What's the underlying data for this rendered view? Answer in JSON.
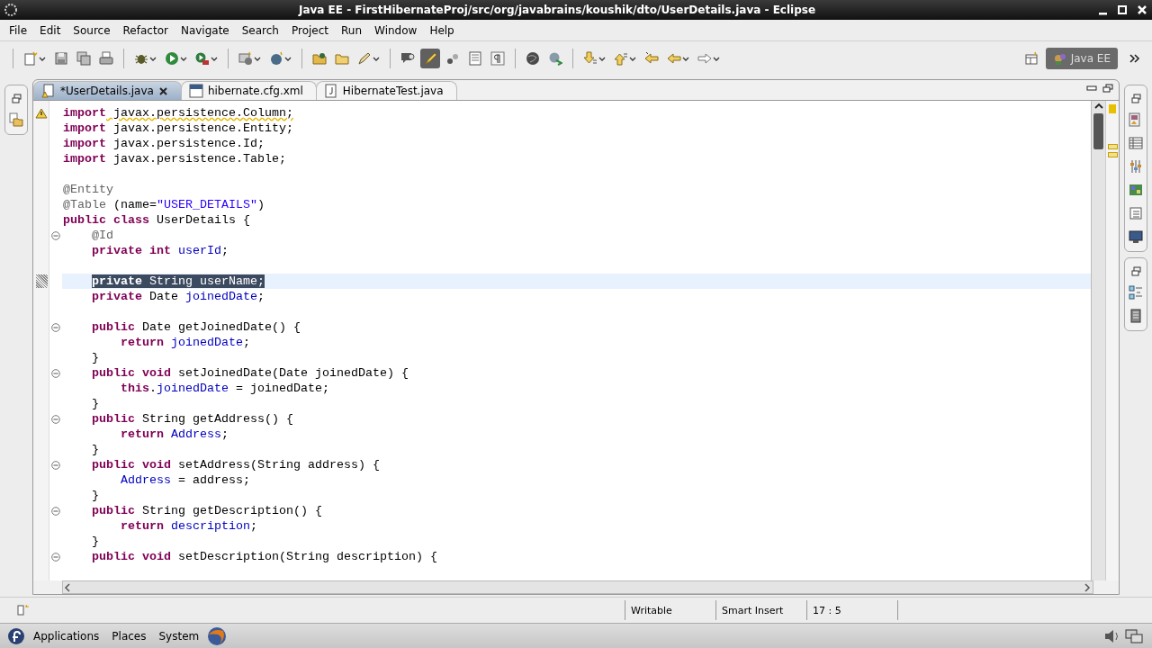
{
  "window": {
    "title": "Java EE - FirstHibernateProj/src/org/javabrains/koushik/dto/UserDetails.java - Eclipse"
  },
  "menu": [
    "File",
    "Edit",
    "Source",
    "Refactor",
    "Navigate",
    "Search",
    "Project",
    "Run",
    "Window",
    "Help"
  ],
  "toolbar": {
    "highlight_toggle": {
      "on": true
    },
    "perspective": {
      "label": "Java EE",
      "selected": true
    }
  },
  "tabs": [
    {
      "label": "*UserDetails.java",
      "kind": "java-warning",
      "selected": true
    },
    {
      "label": "hibernate.cfg.xml",
      "kind": "xml",
      "selected": false
    },
    {
      "label": "HibernateTest.java",
      "kind": "java",
      "selected": false
    }
  ],
  "code": {
    "lines": [
      {
        "kind": "code",
        "warning": true,
        "fold": false,
        "selected": false,
        "tokens": [
          {
            "text": "import",
            "kind": "kw"
          },
          {
            "text": " javax.persistence.Column;",
            "kind": "plain"
          }
        ]
      },
      {
        "kind": "code",
        "warning": false,
        "fold": false,
        "selected": false,
        "tokens": [
          {
            "text": "import",
            "kind": "kw"
          },
          {
            "text": " javax.persistence.Entity;",
            "kind": "plain"
          }
        ]
      },
      {
        "kind": "code",
        "warning": false,
        "fold": false,
        "selected": false,
        "tokens": [
          {
            "text": "import",
            "kind": "kw"
          },
          {
            "text": " javax.persistence.Id;",
            "kind": "plain"
          }
        ]
      },
      {
        "kind": "code",
        "warning": false,
        "fold": false,
        "selected": false,
        "tokens": [
          {
            "text": "import",
            "kind": "kw"
          },
          {
            "text": " javax.persistence.Table;",
            "kind": "plain"
          }
        ]
      },
      {
        "kind": "blank"
      },
      {
        "kind": "code",
        "warning": false,
        "fold": false,
        "selected": false,
        "tokens": [
          {
            "text": "@Entity",
            "kind": "ann"
          }
        ]
      },
      {
        "kind": "code",
        "warning": false,
        "fold": false,
        "selected": false,
        "tokens": [
          {
            "text": "@Table",
            "kind": "ann"
          },
          {
            "text": " (name=",
            "kind": "plain"
          },
          {
            "text": "\"USER_DETAILS\"",
            "kind": "str"
          },
          {
            "text": ")",
            "kind": "plain"
          }
        ]
      },
      {
        "kind": "code",
        "warning": false,
        "fold": false,
        "selected": false,
        "tokens": [
          {
            "text": "public",
            "kind": "kw"
          },
          {
            "text": " class",
            "kind": "kw"
          },
          {
            "text": " UserDetails {",
            "kind": "plain"
          }
        ]
      },
      {
        "kind": "code",
        "warning": false,
        "fold": true,
        "selected": false,
        "tokens": [
          {
            "text": "    @Id",
            "kind": "ann"
          }
        ]
      },
      {
        "kind": "code",
        "warning": false,
        "fold": false,
        "selected": false,
        "tokens": [
          {
            "text": "    private",
            "kind": "kw"
          },
          {
            "text": " int",
            "kind": "kw"
          },
          {
            "text": " userId",
            "kind": "field"
          },
          {
            "text": ";",
            "kind": "plain"
          }
        ]
      },
      {
        "kind": "blank"
      },
      {
        "kind": "code",
        "warning": false,
        "fold": false,
        "selected": true,
        "tokens": [
          {
            "text": "    private",
            "kind": "kw"
          },
          {
            "text": " String ",
            "kind": "plain"
          },
          {
            "text": "userName",
            "kind": "field"
          },
          {
            "text": ";",
            "kind": "plain"
          }
        ]
      },
      {
        "kind": "code",
        "warning": false,
        "fold": false,
        "selected": false,
        "tokens": [
          {
            "text": "    private",
            "kind": "kw"
          },
          {
            "text": " Date ",
            "kind": "plain"
          },
          {
            "text": "joinedDate",
            "kind": "field"
          },
          {
            "text": ";",
            "kind": "plain"
          }
        ]
      },
      {
        "kind": "blank"
      },
      {
        "kind": "code",
        "warning": false,
        "fold": true,
        "selected": false,
        "tokens": [
          {
            "text": "    public",
            "kind": "kw"
          },
          {
            "text": " Date getJoinedDate() {",
            "kind": "plain"
          }
        ]
      },
      {
        "kind": "code",
        "warning": false,
        "fold": false,
        "selected": false,
        "tokens": [
          {
            "text": "        return",
            "kind": "kw"
          },
          {
            "text": " joinedDate",
            "kind": "field"
          },
          {
            "text": ";",
            "kind": "plain"
          }
        ]
      },
      {
        "kind": "code",
        "warning": false,
        "fold": false,
        "selected": false,
        "tokens": [
          {
            "text": "    }",
            "kind": "plain"
          }
        ]
      },
      {
        "kind": "code",
        "warning": false,
        "fold": true,
        "selected": false,
        "tokens": [
          {
            "text": "    public",
            "kind": "kw"
          },
          {
            "text": " void",
            "kind": "kw"
          },
          {
            "text": " setJoinedDate(Date joinedDate) {",
            "kind": "plain"
          }
        ]
      },
      {
        "kind": "code",
        "warning": false,
        "fold": false,
        "selected": false,
        "tokens": [
          {
            "text": "        this",
            "kind": "kw"
          },
          {
            "text": ".",
            "kind": "plain"
          },
          {
            "text": "joinedDate",
            "kind": "field"
          },
          {
            "text": " = joinedDate;",
            "kind": "plain"
          }
        ]
      },
      {
        "kind": "code",
        "warning": false,
        "fold": false,
        "selected": false,
        "tokens": [
          {
            "text": "    }",
            "kind": "plain"
          }
        ]
      },
      {
        "kind": "code",
        "warning": false,
        "fold": true,
        "selected": false,
        "tokens": [
          {
            "text": "    public",
            "kind": "kw"
          },
          {
            "text": " String getAddress() {",
            "kind": "plain"
          }
        ]
      },
      {
        "kind": "code",
        "warning": false,
        "fold": false,
        "selected": false,
        "tokens": [
          {
            "text": "        return",
            "kind": "kw"
          },
          {
            "text": " Address",
            "kind": "field"
          },
          {
            "text": ";",
            "kind": "plain"
          }
        ]
      },
      {
        "kind": "code",
        "warning": false,
        "fold": false,
        "selected": false,
        "tokens": [
          {
            "text": "    }",
            "kind": "plain"
          }
        ]
      },
      {
        "kind": "code",
        "warning": false,
        "fold": true,
        "selected": false,
        "tokens": [
          {
            "text": "    public",
            "kind": "kw"
          },
          {
            "text": " void",
            "kind": "kw"
          },
          {
            "text": " setAddress(String address) {",
            "kind": "plain"
          }
        ]
      },
      {
        "kind": "code",
        "warning": false,
        "fold": false,
        "selected": false,
        "tokens": [
          {
            "text": "        Address",
            "kind": "field"
          },
          {
            "text": " = address;",
            "kind": "plain"
          }
        ]
      },
      {
        "kind": "code",
        "warning": false,
        "fold": false,
        "selected": false,
        "tokens": [
          {
            "text": "    }",
            "kind": "plain"
          }
        ]
      },
      {
        "kind": "code",
        "warning": false,
        "fold": true,
        "selected": false,
        "tokens": [
          {
            "text": "    public",
            "kind": "kw"
          },
          {
            "text": " String getDescription() {",
            "kind": "plain"
          }
        ]
      },
      {
        "kind": "code",
        "warning": false,
        "fold": false,
        "selected": false,
        "tokens": [
          {
            "text": "        return",
            "kind": "kw"
          },
          {
            "text": " description",
            "kind": "field"
          },
          {
            "text": ";",
            "kind": "plain"
          }
        ]
      },
      {
        "kind": "code",
        "warning": false,
        "fold": false,
        "selected": false,
        "tokens": [
          {
            "text": "    }",
            "kind": "plain"
          }
        ]
      },
      {
        "kind": "code",
        "warning": false,
        "fold": true,
        "selected": false,
        "tokens": [
          {
            "text": "    public",
            "kind": "kw"
          },
          {
            "text": " void",
            "kind": "kw"
          },
          {
            "text": " setDescription(String description) {",
            "kind": "plain"
          }
        ]
      }
    ]
  },
  "status_bar": {
    "fields": [
      "Writable",
      "Smart Insert",
      "17 : 5"
    ]
  },
  "taskbar": {
    "menus": [
      "Applications",
      "Places",
      "System"
    ]
  }
}
